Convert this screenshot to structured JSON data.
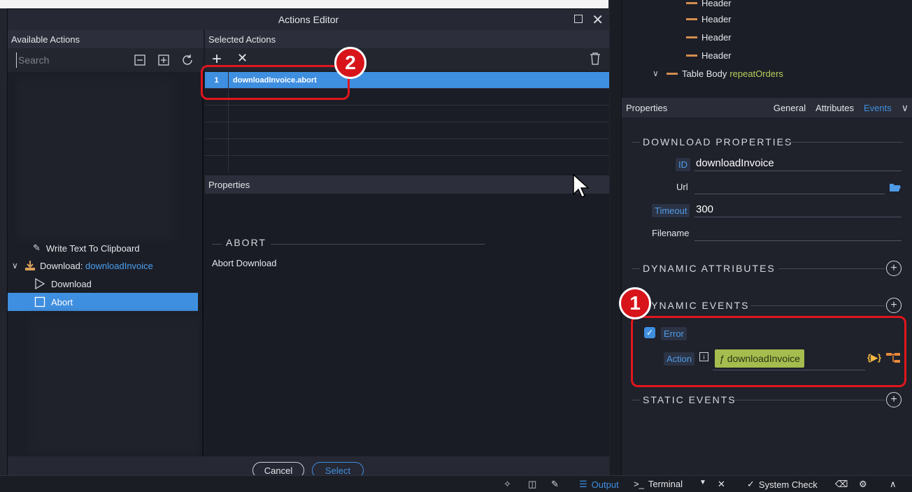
{
  "dialog": {
    "title": "Actions Editor",
    "available_header": "Available Actions",
    "selected_header": "Selected Actions",
    "properties_header": "Properties",
    "search_placeholder": "Search",
    "tree": {
      "clipboard_item": "Write Text To Clipboard",
      "download_group_prefix": "Download: ",
      "download_group_id": "downloadInvoice",
      "items": [
        "Download",
        "Abort"
      ]
    },
    "selected_actions": [
      {
        "index": "1",
        "value": "downloadInvoice.abort"
      }
    ],
    "abort_section_title": "ABORT",
    "abort_description": "Abort Download",
    "cancel_label": "Cancel",
    "select_label": "Select"
  },
  "right": {
    "tree_rows": [
      "Header",
      "Header",
      "Header",
      "Header"
    ],
    "table_body_label": "Table Body",
    "table_body_id": "repeatOrders",
    "properties_title": "Properties",
    "tabs": [
      "General",
      "Attributes",
      "Events"
    ],
    "active_tab": "Events",
    "download_properties": "DOWNLOAD PROPERTIES",
    "fields": {
      "id_label": "ID",
      "id_value": "downloadInvoice",
      "url_label": "Url",
      "url_value": "",
      "timeout_label": "Timeout",
      "timeout_value": "300",
      "filename_label": "Filename",
      "filename_value": ""
    },
    "dynamic_attributes": "DYNAMIC ATTRIBUTES",
    "dynamic_events": "DYNAMIC EVENTS",
    "event_name": "Error",
    "action_label": "Action",
    "action_value": "downloadInvoice",
    "static_events": "STATIC EVENTS"
  },
  "badges": {
    "one": "1",
    "two": "2"
  },
  "status_bar": {
    "output": "Output",
    "terminal": "Terminal",
    "system_check": "System Check"
  },
  "colors": {
    "accent_blue": "#3f8fe0",
    "highlight_red": "#e0161d",
    "function_green": "#a5bd4e",
    "tree_orange": "#d38d4f"
  }
}
